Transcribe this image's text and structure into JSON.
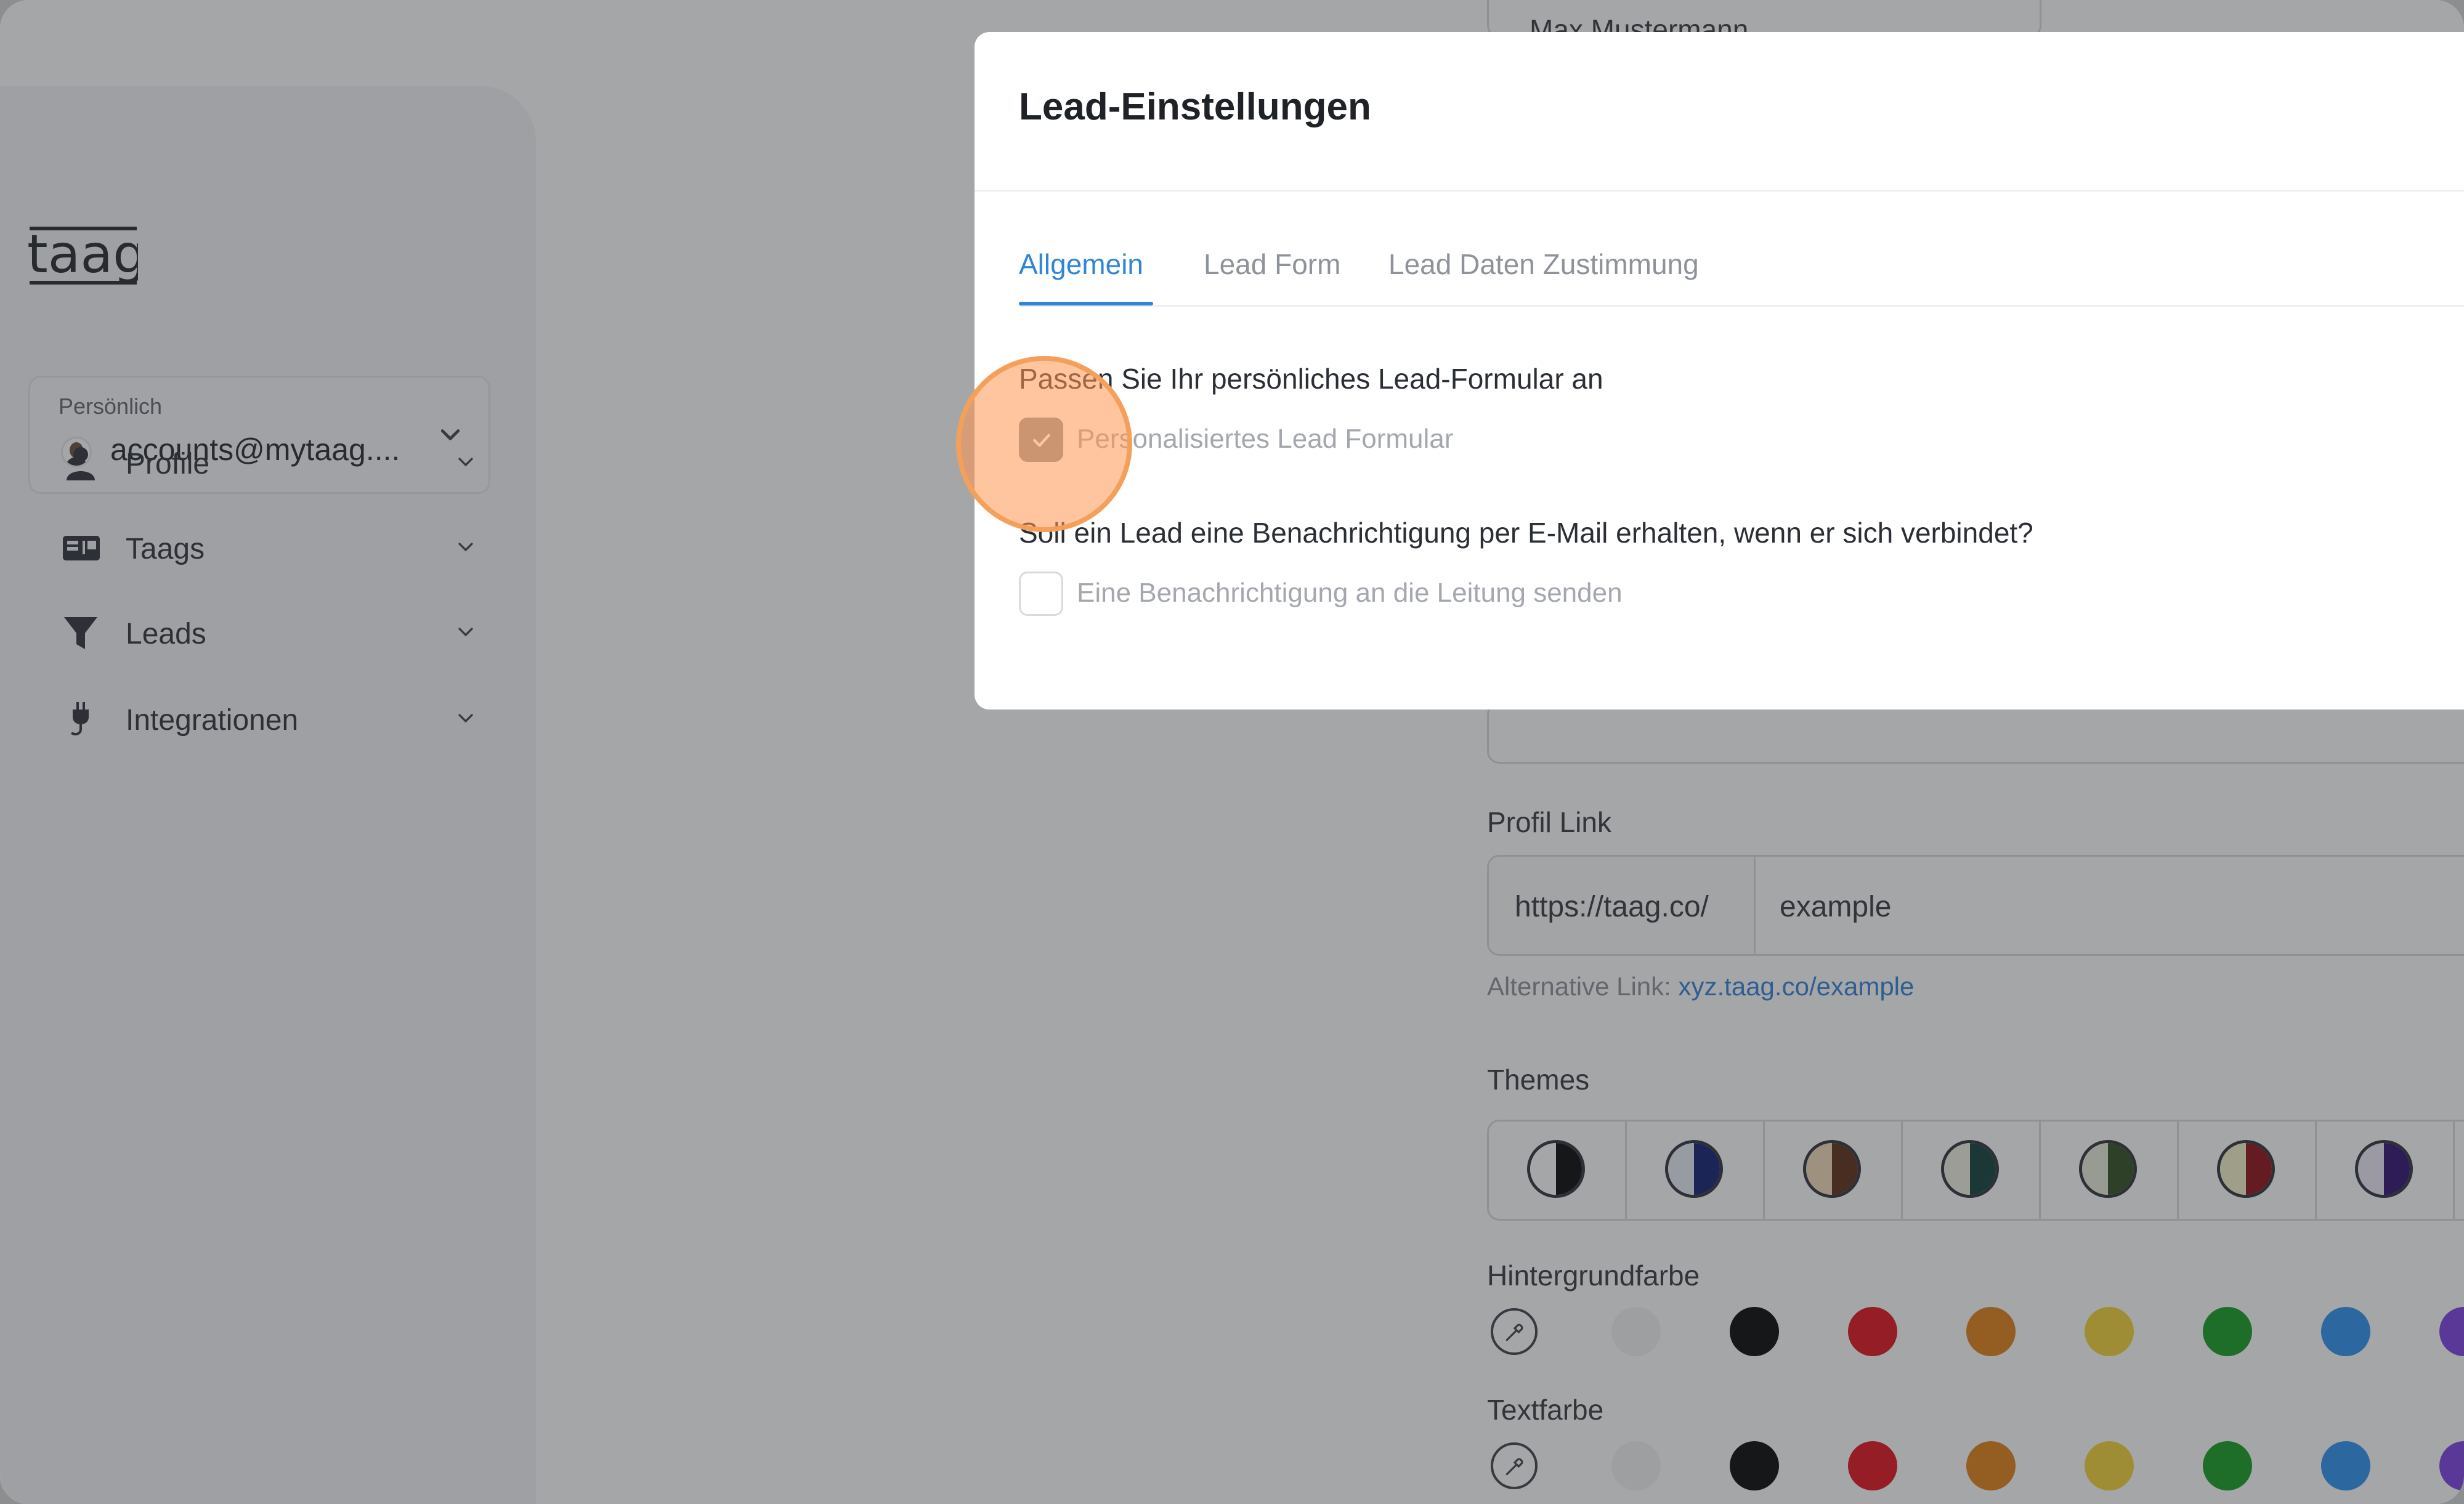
{
  "app": {
    "logo_text": "taag"
  },
  "account": {
    "caption": "Persönlich",
    "email": "accounts@mytaag...."
  },
  "sidebar": {
    "items": [
      {
        "label": "Profile",
        "icon": "person-icon"
      },
      {
        "label": "Taags",
        "icon": "id-card-icon"
      },
      {
        "label": "Leads",
        "icon": "funnel-icon"
      },
      {
        "label": "Integrationen",
        "icon": "plug-icon"
      }
    ]
  },
  "profile_form": {
    "name_value": "Max Mustermann",
    "profile_link_label": "Profil Link",
    "link_prefix": "https://taag.co/",
    "link_value": "example",
    "alt_link_label": "Alternative Link:",
    "alt_link_value": "xyz.taag.co/example",
    "themes_label": "Themes",
    "themes": [
      {
        "left": "#ffffff",
        "right": "#000000"
      },
      {
        "left": "#e6ecf5",
        "right": "#0a1a6e"
      },
      {
        "left": "#f3d9b8",
        "right": "#5a2a10"
      },
      {
        "left": "#f1efe0",
        "right": "#0b3b34"
      },
      {
        "left": "#e7ecd6",
        "right": "#2c4a1c"
      },
      {
        "left": "#f5f1c8",
        "right": "#8b0a10"
      },
      {
        "left": "#eee8f7",
        "right": "#2a0a6e"
      }
    ],
    "background_label": "Hintergrundfarbe",
    "text_color_label": "Textfarbe",
    "swatches": [
      "#f2f2f2",
      "#000000",
      "#e30b17",
      "#e07f10",
      "#f5d232",
      "#0f9a1c",
      "#2a8ff0",
      "#7a3be0"
    ]
  },
  "modal": {
    "title": "Lead-Einstellungen",
    "tabs": [
      "Allgemein",
      "Lead Form",
      "Lead Daten Zustimmung"
    ],
    "active_tab": "Allgemein",
    "section1_question": "Passen Sie Ihr persönliches Lead-Formular an",
    "section1_option": "Personalisiertes Lead Formular",
    "section1_checked": true,
    "section2_question": "Soll ein Lead eine Benachrichtigung per E-Mail erhalten, wenn er sich verbindet?",
    "section2_option": "Eine Benachrichtigung an die Leitung senden",
    "section2_checked": false
  },
  "colors": {
    "accent": "#2f86d6",
    "highlight": "#f5a05a"
  }
}
